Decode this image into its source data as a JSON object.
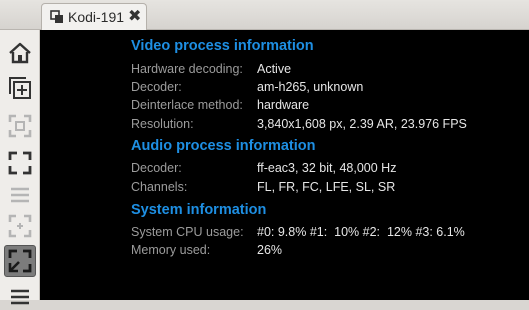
{
  "tab": {
    "title": "Kodi-191",
    "close_glyph": "✖"
  },
  "toolbar": {
    "items": [
      {
        "icon": "home-icon"
      },
      {
        "icon": "add-window-icon"
      },
      {
        "icon": "fullscreen-dim-icon"
      },
      {
        "icon": "fullscreen-icon"
      },
      {
        "icon": "menu-dim-icon"
      },
      {
        "icon": "scale-dim-icon"
      },
      {
        "icon": "scale-active-icon"
      },
      {
        "icon": "menu-icon"
      }
    ]
  },
  "video": {
    "title": "Video process information",
    "rows": [
      {
        "label": "Hardware decoding:",
        "value": "Active"
      },
      {
        "label": "Decoder:",
        "value": "am-h265, unknown"
      },
      {
        "label": "Deinterlace method:",
        "value": "hardware"
      },
      {
        "label": "Resolution:",
        "value": "3,840x1,608 px, 2.39 AR, 23.976 FPS"
      }
    ]
  },
  "audio": {
    "title": "Audio process information",
    "rows": [
      {
        "label": "Decoder:",
        "value": "ff-eac3, 32 bit, 48,000 Hz"
      },
      {
        "label": "Channels:",
        "value": "FL, FR, FC, LFE, SL, SR"
      }
    ]
  },
  "system": {
    "title": "System information",
    "rows": [
      {
        "label": "System CPU usage:",
        "value": "#0: 9.8% #1:  10% #2:  12% #3: 6.1%"
      },
      {
        "label": "Memory used:",
        "value": "26%"
      }
    ]
  },
  "colors": {
    "accent": "#1e8fe3",
    "label": "#9c9c9c",
    "value": "#e6e6e6",
    "background": "#000000"
  }
}
